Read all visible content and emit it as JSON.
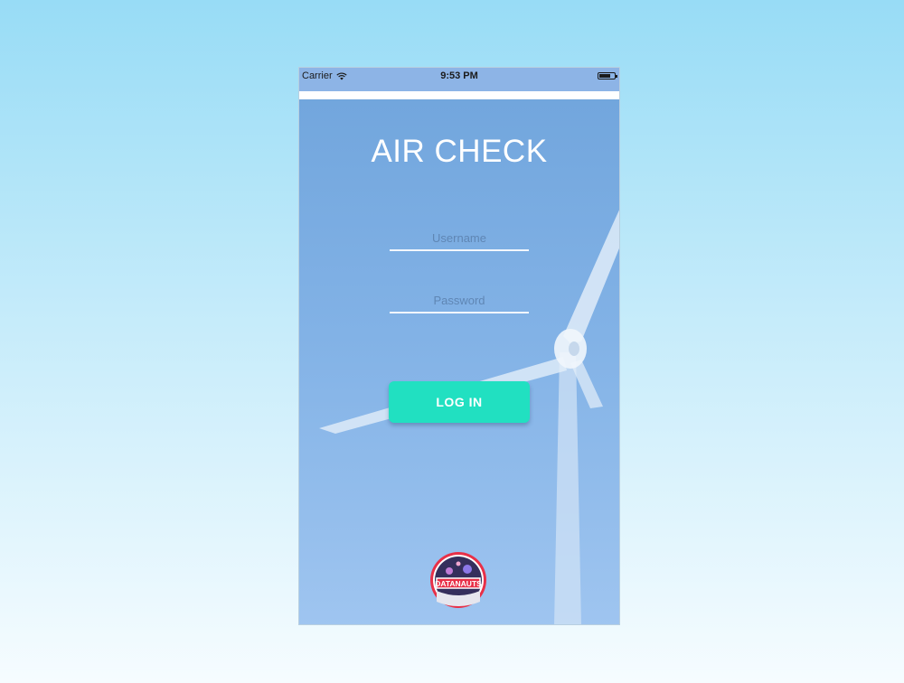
{
  "status_bar": {
    "carrier": "Carrier",
    "time": "9:53 PM"
  },
  "app": {
    "title": "AIR CHECK"
  },
  "form": {
    "username_placeholder": "Username",
    "password_placeholder": "Password",
    "login_label": "LOG IN"
  },
  "logo": {
    "text": "DATANAUTS"
  },
  "colors": {
    "background_top": "#98dcf6",
    "screen_blue": "#7aaee2",
    "accent": "#21e0c1",
    "logo_ring": "#e83048"
  },
  "icons": {
    "wifi": "wifi-icon",
    "battery": "battery-icon"
  }
}
